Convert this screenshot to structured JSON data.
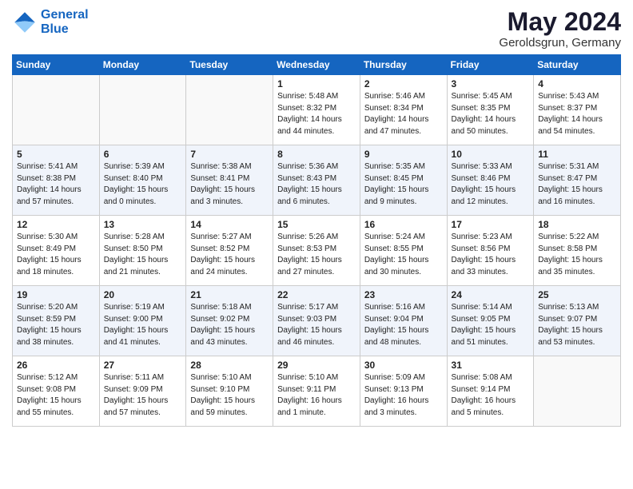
{
  "logo": {
    "line1": "General",
    "line2": "Blue"
  },
  "title": "May 2024",
  "subtitle": "Geroldsgrun, Germany",
  "weekdays": [
    "Sunday",
    "Monday",
    "Tuesday",
    "Wednesday",
    "Thursday",
    "Friday",
    "Saturday"
  ],
  "weeks": [
    [
      {
        "day": "",
        "info": ""
      },
      {
        "day": "",
        "info": ""
      },
      {
        "day": "",
        "info": ""
      },
      {
        "day": "1",
        "info": "Sunrise: 5:48 AM\nSunset: 8:32 PM\nDaylight: 14 hours\nand 44 minutes."
      },
      {
        "day": "2",
        "info": "Sunrise: 5:46 AM\nSunset: 8:34 PM\nDaylight: 14 hours\nand 47 minutes."
      },
      {
        "day": "3",
        "info": "Sunrise: 5:45 AM\nSunset: 8:35 PM\nDaylight: 14 hours\nand 50 minutes."
      },
      {
        "day": "4",
        "info": "Sunrise: 5:43 AM\nSunset: 8:37 PM\nDaylight: 14 hours\nand 54 minutes."
      }
    ],
    [
      {
        "day": "5",
        "info": "Sunrise: 5:41 AM\nSunset: 8:38 PM\nDaylight: 14 hours\nand 57 minutes."
      },
      {
        "day": "6",
        "info": "Sunrise: 5:39 AM\nSunset: 8:40 PM\nDaylight: 15 hours\nand 0 minutes."
      },
      {
        "day": "7",
        "info": "Sunrise: 5:38 AM\nSunset: 8:41 PM\nDaylight: 15 hours\nand 3 minutes."
      },
      {
        "day": "8",
        "info": "Sunrise: 5:36 AM\nSunset: 8:43 PM\nDaylight: 15 hours\nand 6 minutes."
      },
      {
        "day": "9",
        "info": "Sunrise: 5:35 AM\nSunset: 8:45 PM\nDaylight: 15 hours\nand 9 minutes."
      },
      {
        "day": "10",
        "info": "Sunrise: 5:33 AM\nSunset: 8:46 PM\nDaylight: 15 hours\nand 12 minutes."
      },
      {
        "day": "11",
        "info": "Sunrise: 5:31 AM\nSunset: 8:47 PM\nDaylight: 15 hours\nand 16 minutes."
      }
    ],
    [
      {
        "day": "12",
        "info": "Sunrise: 5:30 AM\nSunset: 8:49 PM\nDaylight: 15 hours\nand 18 minutes."
      },
      {
        "day": "13",
        "info": "Sunrise: 5:28 AM\nSunset: 8:50 PM\nDaylight: 15 hours\nand 21 minutes."
      },
      {
        "day": "14",
        "info": "Sunrise: 5:27 AM\nSunset: 8:52 PM\nDaylight: 15 hours\nand 24 minutes."
      },
      {
        "day": "15",
        "info": "Sunrise: 5:26 AM\nSunset: 8:53 PM\nDaylight: 15 hours\nand 27 minutes."
      },
      {
        "day": "16",
        "info": "Sunrise: 5:24 AM\nSunset: 8:55 PM\nDaylight: 15 hours\nand 30 minutes."
      },
      {
        "day": "17",
        "info": "Sunrise: 5:23 AM\nSunset: 8:56 PM\nDaylight: 15 hours\nand 33 minutes."
      },
      {
        "day": "18",
        "info": "Sunrise: 5:22 AM\nSunset: 8:58 PM\nDaylight: 15 hours\nand 35 minutes."
      }
    ],
    [
      {
        "day": "19",
        "info": "Sunrise: 5:20 AM\nSunset: 8:59 PM\nDaylight: 15 hours\nand 38 minutes."
      },
      {
        "day": "20",
        "info": "Sunrise: 5:19 AM\nSunset: 9:00 PM\nDaylight: 15 hours\nand 41 minutes."
      },
      {
        "day": "21",
        "info": "Sunrise: 5:18 AM\nSunset: 9:02 PM\nDaylight: 15 hours\nand 43 minutes."
      },
      {
        "day": "22",
        "info": "Sunrise: 5:17 AM\nSunset: 9:03 PM\nDaylight: 15 hours\nand 46 minutes."
      },
      {
        "day": "23",
        "info": "Sunrise: 5:16 AM\nSunset: 9:04 PM\nDaylight: 15 hours\nand 48 minutes."
      },
      {
        "day": "24",
        "info": "Sunrise: 5:14 AM\nSunset: 9:05 PM\nDaylight: 15 hours\nand 51 minutes."
      },
      {
        "day": "25",
        "info": "Sunrise: 5:13 AM\nSunset: 9:07 PM\nDaylight: 15 hours\nand 53 minutes."
      }
    ],
    [
      {
        "day": "26",
        "info": "Sunrise: 5:12 AM\nSunset: 9:08 PM\nDaylight: 15 hours\nand 55 minutes."
      },
      {
        "day": "27",
        "info": "Sunrise: 5:11 AM\nSunset: 9:09 PM\nDaylight: 15 hours\nand 57 minutes."
      },
      {
        "day": "28",
        "info": "Sunrise: 5:10 AM\nSunset: 9:10 PM\nDaylight: 15 hours\nand 59 minutes."
      },
      {
        "day": "29",
        "info": "Sunrise: 5:10 AM\nSunset: 9:11 PM\nDaylight: 16 hours\nand 1 minute."
      },
      {
        "day": "30",
        "info": "Sunrise: 5:09 AM\nSunset: 9:13 PM\nDaylight: 16 hours\nand 3 minutes."
      },
      {
        "day": "31",
        "info": "Sunrise: 5:08 AM\nSunset: 9:14 PM\nDaylight: 16 hours\nand 5 minutes."
      },
      {
        "day": "",
        "info": ""
      }
    ]
  ]
}
